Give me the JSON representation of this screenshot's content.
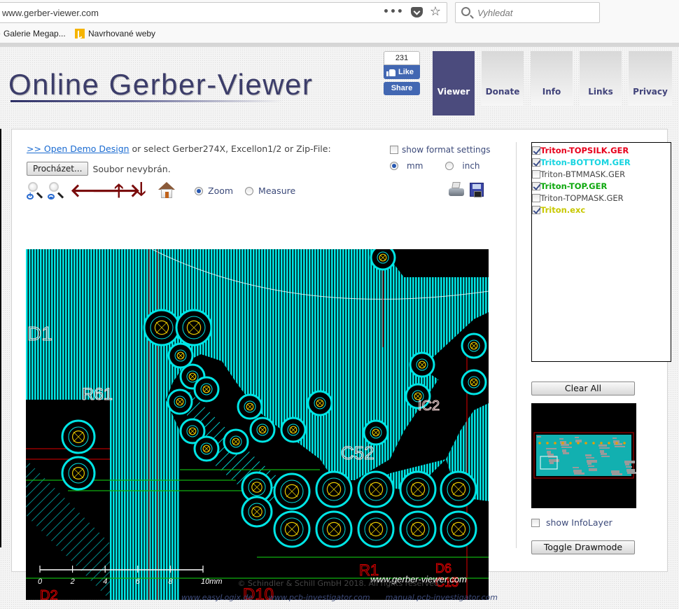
{
  "browser": {
    "url": "www.gerber-viewer.com",
    "search_placeholder": "Vyhledat",
    "bookmarks": [
      {
        "label": "Galerie Megap...",
        "icon": "ie-icon"
      },
      {
        "label": "Navrhované weby",
        "icon": "bing-icon"
      }
    ]
  },
  "header": {
    "logo": "Online Gerber-Viewer",
    "facebook": {
      "count": "231",
      "like_label": "Like",
      "share_label": "Share"
    },
    "nav": [
      {
        "label": "Viewer",
        "active": true
      },
      {
        "label": "Donate",
        "active": false
      },
      {
        "label": "Info",
        "active": false
      },
      {
        "label": "Links",
        "active": false
      },
      {
        "label": "Privacy",
        "active": false
      }
    ]
  },
  "viewer": {
    "demo_link": ">> Open Demo Design",
    "intro_text": " or select Gerber274X, Excellon1/2 or Zip-File:",
    "browse_button": "Procházet...",
    "file_status": "Soubor nevybrán.",
    "format_settings_label": "show format settings",
    "format_settings_checked": false,
    "units": [
      {
        "label": "mm",
        "selected": true
      },
      {
        "label": "inch",
        "selected": false
      }
    ],
    "toolbar": {
      "tools": [
        "zoom-in-icon",
        "zoom-out-icon",
        "arrow-left-icon",
        "arrow-right-icon",
        "arrow-up-icon",
        "arrow-down-icon",
        "home-icon"
      ],
      "modes": [
        {
          "label": "Zoom",
          "selected": true
        },
        {
          "label": "Measure",
          "selected": false
        }
      ],
      "print_icon": "printer-icon",
      "save_icon": "floppy-disk-icon"
    },
    "canvas": {
      "watermark": "www.gerber-viewer.com",
      "scale_labels": [
        "0",
        "2",
        "4",
        "6",
        "8",
        "10mm"
      ],
      "silk_labels": [
        "D1",
        "R61",
        "C52",
        "R1",
        "D6",
        "C15",
        "D10",
        "D2",
        "IC2"
      ]
    }
  },
  "layers": [
    {
      "name": "Triton-TOPSILK.GER",
      "checked": true,
      "color": "#e8001c"
    },
    {
      "name": "Triton-BOTTOM.GER",
      "checked": true,
      "color": "#17d4e0"
    },
    {
      "name": "Triton-BTMMASK.GER",
      "checked": false,
      "color": "#444444"
    },
    {
      "name": "Triton-TOP.GER",
      "checked": true,
      "color": "#0fa80f"
    },
    {
      "name": "Triton-TOPMASK.GER",
      "checked": false,
      "color": "#444444"
    },
    {
      "name": "Triton.exc",
      "checked": true,
      "color": "#c8c800"
    }
  ],
  "sidebar": {
    "clear_all": "Clear All",
    "show_infolayer": "show InfoLayer",
    "show_infolayer_checked": false,
    "toggle_drawmode": "Toggle Drawmode"
  },
  "footer": {
    "copyright": "© Schindler & Schill GmbH 2018. All rights reserved.",
    "links": [
      "www.easyLogix.de",
      "www.pcb-investigator.com",
      "manual.pcb-investigator.com"
    ]
  },
  "colors": {
    "nav_active": "#4b4b7d",
    "bottom_copper": "#00e5e5",
    "top_copper": "#10b010",
    "silk": "#e00000",
    "drill": "#e8c800",
    "link": "#1a6bd1"
  }
}
